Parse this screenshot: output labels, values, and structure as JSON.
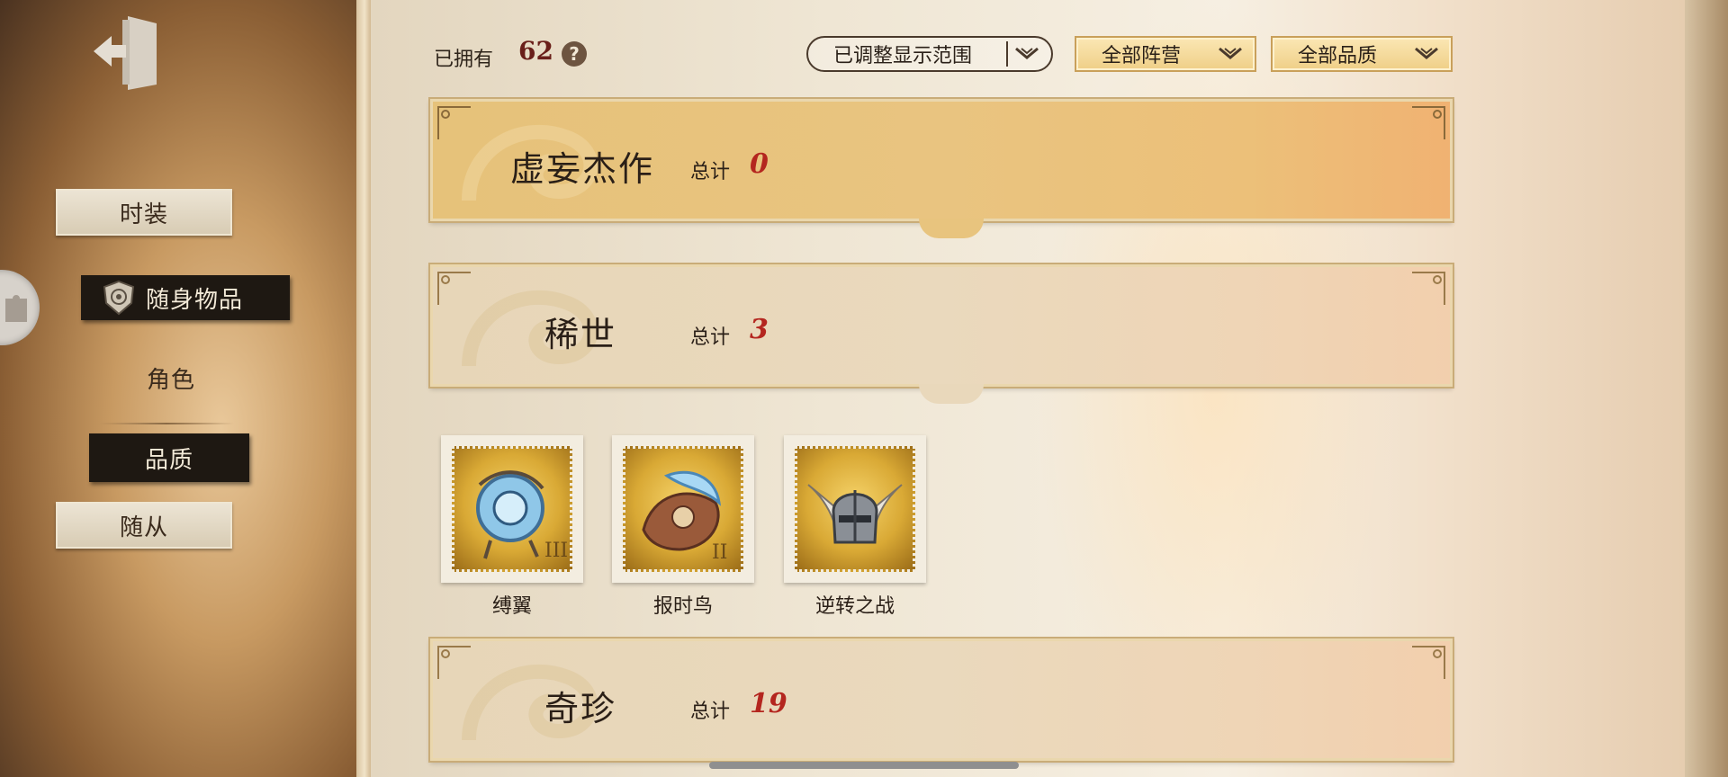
{
  "header": {
    "owned_label": "已拥有",
    "owned_count": "62",
    "help_glyph": "?"
  },
  "filters": [
    {
      "label": "已调整显示范围",
      "style": "outline"
    },
    {
      "label": "全部阵营",
      "style": "gold"
    },
    {
      "label": "全部品质",
      "style": "gold"
    }
  ],
  "sidebar": {
    "tabs": [
      {
        "label": "时装",
        "style": "paper"
      },
      {
        "label": "随身物品",
        "style": "dark",
        "icon": "shield-emblem-icon"
      },
      {
        "label": "角色",
        "style": "plain"
      },
      {
        "label": "品质",
        "style": "dark"
      },
      {
        "label": "随从",
        "style": "paper"
      }
    ]
  },
  "categories": [
    {
      "title": "虚妄杰作",
      "total_label": "总计",
      "total": "0",
      "style": "gold"
    },
    {
      "title": "稀世",
      "total_label": "总计",
      "total": "3",
      "style": "pale"
    },
    {
      "title": "奇珍",
      "total_label": "总计",
      "total": "19",
      "style": "pale"
    }
  ],
  "items": [
    {
      "name": "缚翼",
      "icon": "bound-wings-orb-icon"
    },
    {
      "name": "报时鸟",
      "icon": "clock-bird-icon"
    },
    {
      "name": "逆转之战",
      "icon": "winged-helmet-icon"
    }
  ],
  "colors": {
    "count_red": "#b4261f",
    "owned_count": "#6a1f1a",
    "gold_banner": "#e6c27a",
    "pale_banner": "#e7d6b8"
  }
}
